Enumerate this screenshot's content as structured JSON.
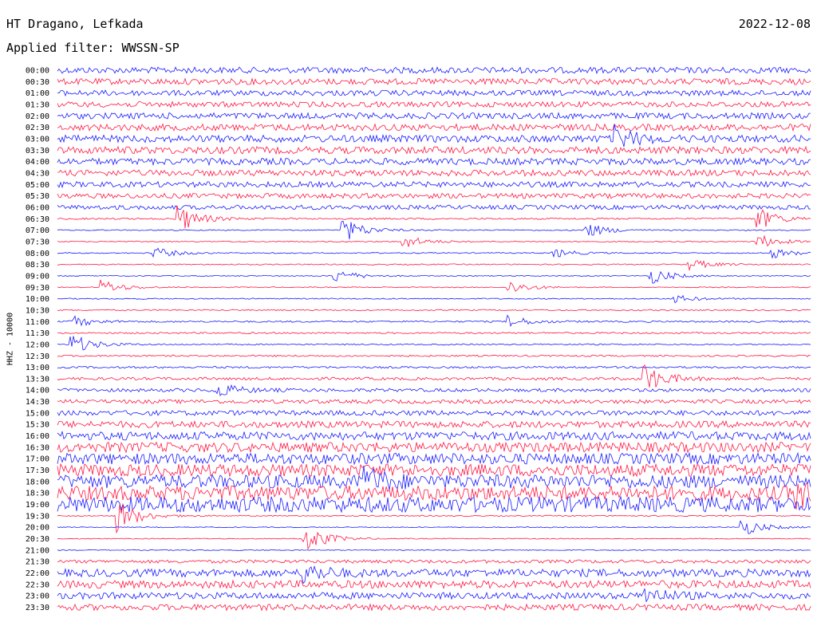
{
  "header": {
    "station": "HT Dragano, Lefkada",
    "date": "2022-12-08",
    "filter": "Applied filter: WWSSN-SP"
  },
  "colors": {
    "a": "#ff1744",
    "b": "#1a1aff",
    "background": "#ffffff"
  },
  "chart_data": {
    "type": "line",
    "title": "HT Dragano, Lefkada",
    "subtitle": "Applied filter: WWSSN-SP",
    "ylabel": "HHZ - 10000",
    "xlabel": "",
    "grid": false,
    "traces": [
      {
        "label": "00:00",
        "color": "b",
        "amp": 0.55
      },
      {
        "label": "00:30",
        "color": "a",
        "amp": 0.55
      },
      {
        "label": "01:00",
        "color": "b",
        "amp": 0.5
      },
      {
        "label": "01:30",
        "color": "a",
        "amp": 0.5
      },
      {
        "label": "02:00",
        "color": "b",
        "amp": 0.55
      },
      {
        "label": "02:30",
        "color": "a",
        "amp": 0.6
      },
      {
        "label": "03:00",
        "color": "b",
        "amp": 0.65
      },
      {
        "label": "03:30",
        "color": "a",
        "amp": 0.65
      },
      {
        "label": "04:00",
        "color": "b",
        "amp": 0.6
      },
      {
        "label": "04:30",
        "color": "a",
        "amp": 0.55
      },
      {
        "label": "05:00",
        "color": "b",
        "amp": 0.5
      },
      {
        "label": "05:30",
        "color": "a",
        "amp": 0.45
      },
      {
        "label": "06:00",
        "color": "b",
        "amp": 0.4
      },
      {
        "label": "06:30",
        "color": "a",
        "amp": 0.15
      },
      {
        "label": "07:00",
        "color": "b",
        "amp": 0.1
      },
      {
        "label": "07:30",
        "color": "a",
        "amp": 0.1
      },
      {
        "label": "08:00",
        "color": "b",
        "amp": 0.1
      },
      {
        "label": "08:30",
        "color": "a",
        "amp": 0.1
      },
      {
        "label": "09:00",
        "color": "b",
        "amp": 0.08
      },
      {
        "label": "09:30",
        "color": "a",
        "amp": 0.08
      },
      {
        "label": "10:00",
        "color": "b",
        "amp": 0.1
      },
      {
        "label": "10:30",
        "color": "a",
        "amp": 0.12
      },
      {
        "label": "11:00",
        "color": "b",
        "amp": 0.15
      },
      {
        "label": "11:30",
        "color": "a",
        "amp": 0.15
      },
      {
        "label": "12:00",
        "color": "b",
        "amp": 0.12
      },
      {
        "label": "12:30",
        "color": "a",
        "amp": 0.15
      },
      {
        "label": "13:00",
        "color": "b",
        "amp": 0.18
      },
      {
        "label": "13:30",
        "color": "a",
        "amp": 0.25
      },
      {
        "label": "14:00",
        "color": "b",
        "amp": 0.3
      },
      {
        "label": "14:30",
        "color": "a",
        "amp": 0.35
      },
      {
        "label": "15:00",
        "color": "b",
        "amp": 0.45
      },
      {
        "label": "15:30",
        "color": "a",
        "amp": 0.6
      },
      {
        "label": "16:00",
        "color": "b",
        "amp": 0.75
      },
      {
        "label": "16:30",
        "color": "a",
        "amp": 0.9
      },
      {
        "label": "17:00",
        "color": "b",
        "amp": 1.0
      },
      {
        "label": "17:30",
        "color": "a",
        "amp": 1.1
      },
      {
        "label": "18:00",
        "color": "b",
        "amp": 1.2
      },
      {
        "label": "18:30",
        "color": "a",
        "amp": 1.3
      },
      {
        "label": "19:00",
        "color": "b",
        "amp": 1.4
      },
      {
        "label": "19:30",
        "color": "a",
        "amp": 0.1
      },
      {
        "label": "20:00",
        "color": "b",
        "amp": 0.08
      },
      {
        "label": "20:30",
        "color": "a",
        "amp": 0.08
      },
      {
        "label": "21:00",
        "color": "b",
        "amp": 0.08
      },
      {
        "label": "21:30",
        "color": "a",
        "amp": 0.3
      },
      {
        "label": "22:00",
        "color": "b",
        "amp": 0.7
      },
      {
        "label": "22:30",
        "color": "a",
        "amp": 0.7
      },
      {
        "label": "23:00",
        "color": "b",
        "amp": 0.6
      },
      {
        "label": "23:30",
        "color": "a",
        "amp": 0.55
      }
    ],
    "events": [
      {
        "trace": 6,
        "t": 0.74,
        "amp": 2.0
      },
      {
        "trace": 13,
        "t": 0.16,
        "amp": 2.5
      },
      {
        "trace": 13,
        "t": 0.93,
        "amp": 2.0
      },
      {
        "trace": 14,
        "t": 0.38,
        "amp": 2.2
      },
      {
        "trace": 14,
        "t": 0.7,
        "amp": 1.5
      },
      {
        "trace": 15,
        "t": 0.46,
        "amp": 1.2
      },
      {
        "trace": 15,
        "t": 0.93,
        "amp": 1.3
      },
      {
        "trace": 16,
        "t": 0.13,
        "amp": 1.0
      },
      {
        "trace": 16,
        "t": 0.66,
        "amp": 0.8
      },
      {
        "trace": 16,
        "t": 0.95,
        "amp": 0.9
      },
      {
        "trace": 17,
        "t": 0.84,
        "amp": 1.0
      },
      {
        "trace": 18,
        "t": 0.37,
        "amp": 1.2
      },
      {
        "trace": 18,
        "t": 0.79,
        "amp": 1.4
      },
      {
        "trace": 19,
        "t": 0.06,
        "amp": 1.3
      },
      {
        "trace": 19,
        "t": 0.6,
        "amp": 1.2
      },
      {
        "trace": 20,
        "t": 0.82,
        "amp": 0.7
      },
      {
        "trace": 22,
        "t": 0.02,
        "amp": 1.0
      },
      {
        "trace": 22,
        "t": 0.6,
        "amp": 1.0
      },
      {
        "trace": 24,
        "t": 0.02,
        "amp": 1.8
      },
      {
        "trace": 27,
        "t": 0.78,
        "amp": 2.6
      },
      {
        "trace": 28,
        "t": 0.21,
        "amp": 1.4
      },
      {
        "trace": 36,
        "t": 0.41,
        "amp": 2.0
      },
      {
        "trace": 37,
        "t": 0.98,
        "amp": 2.0
      },
      {
        "trace": 39,
        "t": 0.08,
        "amp": 3.0
      },
      {
        "trace": 40,
        "t": 0.91,
        "amp": 1.6
      },
      {
        "trace": 41,
        "t": 0.33,
        "amp": 2.6
      },
      {
        "trace": 44,
        "t": 0.33,
        "amp": 1.5
      },
      {
        "trace": 46,
        "t": 0.78,
        "amp": 1.5
      }
    ]
  }
}
